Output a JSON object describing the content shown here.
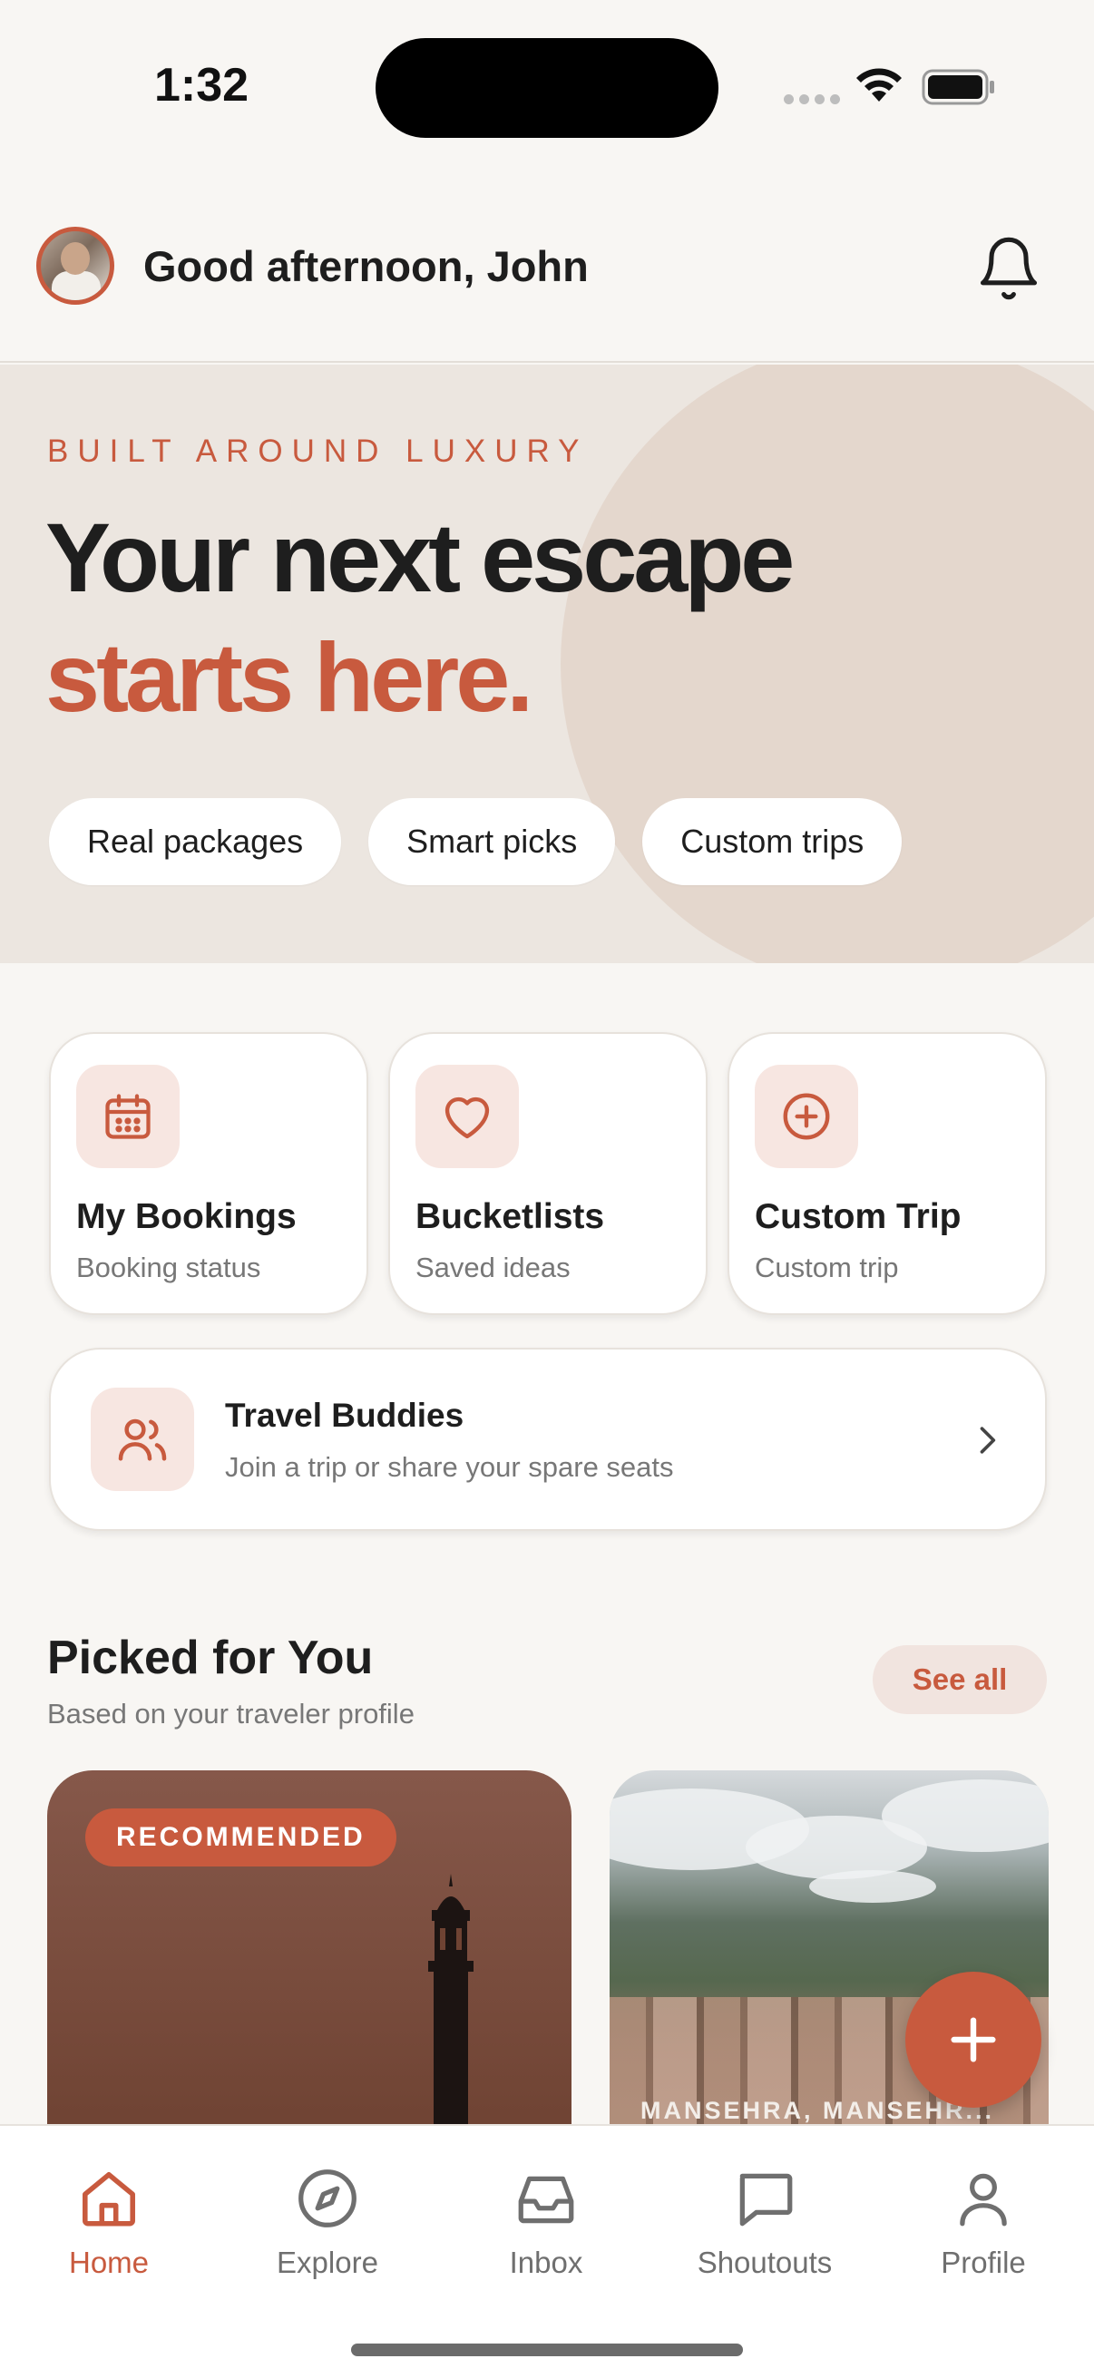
{
  "status_bar": {
    "time": "1:32"
  },
  "header": {
    "greeting": "Good afternoon, John"
  },
  "hero": {
    "eyebrow": "BUILT AROUND LUXURY",
    "title_line1": "Your next escape",
    "title_line2": "starts here.",
    "chips": [
      "Real packages",
      "Smart picks",
      "Custom trips"
    ]
  },
  "quick_cards": [
    {
      "title": "My Bookings",
      "subtitle": "Booking status",
      "icon": "calendar-icon"
    },
    {
      "title": "Bucketlists",
      "subtitle": "Saved ideas",
      "icon": "heart-icon"
    },
    {
      "title": "Custom Trip",
      "subtitle": "Custom trip",
      "icon": "plus-circle-icon"
    }
  ],
  "travel_buddies": {
    "title": "Travel Buddies",
    "subtitle": "Join a trip or share your spare seats"
  },
  "picked": {
    "title": "Picked for You",
    "subtitle": "Based on your traveler profile",
    "see_all": "See all",
    "cards": [
      {
        "badge": "RECOMMENDED"
      },
      {
        "location": "MANSEHRA, MANSEHR..."
      }
    ]
  },
  "tabs": [
    {
      "label": "Home",
      "icon": "home-icon",
      "active": true
    },
    {
      "label": "Explore",
      "icon": "compass-icon",
      "active": false
    },
    {
      "label": "Inbox",
      "icon": "inbox-icon",
      "active": false
    },
    {
      "label": "Shoutouts",
      "icon": "chat-icon",
      "active": false
    },
    {
      "label": "Profile",
      "icon": "user-icon",
      "active": false
    }
  ],
  "colors": {
    "accent": "#c85a3e",
    "background": "#f8f6f3",
    "hero_bg": "#ece6e0"
  }
}
